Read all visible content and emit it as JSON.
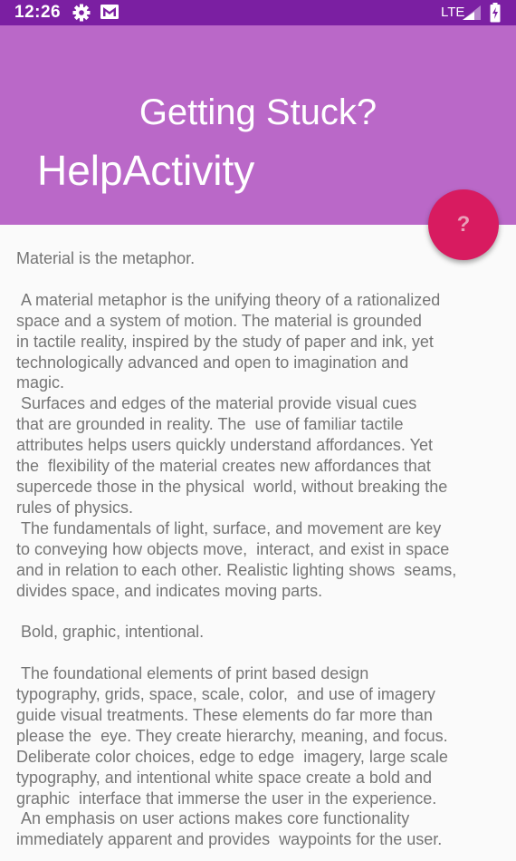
{
  "status_bar": {
    "time": "12:26",
    "network": "LTE",
    "icons": [
      "gear-icon",
      "mail-icon",
      "signal-icon",
      "battery-icon"
    ],
    "color": "#7b1fa2"
  },
  "app_bar": {
    "title": "Getting Stuck?",
    "subtitle": "HelpActivity",
    "color": "#ba68c8"
  },
  "fab": {
    "icon": "question-mark-icon",
    "glyph": "?",
    "color": "#d81b60"
  },
  "content": {
    "text": "Material is the metaphor.\n\n A material metaphor is the unifying theory of a rationalized\nspace and a system of motion. The material is grounded\nin tactile reality, inspired by the study of paper and ink, yet\ntechnologically advanced and open to imagination and\nmagic.\n Surfaces and edges of the material provide visual cues\nthat are grounded in reality. The  use of familiar tactile\nattributes helps users quickly understand affordances. Yet\nthe  flexibility of the material creates new affordances that\nsupercede those in the physical  world, without breaking the\nrules of physics.\n The fundamentals of light, surface, and movement are key\nto conveying how objects move,  interact, and exist in space\nand in relation to each other. Realistic lighting shows  seams,\ndivides space, and indicates moving parts.\n\n Bold, graphic, intentional.\n\n The foundational elements of print based design\ntypography, grids, space, scale, color,  and use of imagery\nguide visual treatments. These elements do far more than\nplease the  eye. They create hierarchy, meaning, and focus.\nDeliberate color choices, edge to edge  imagery, large scale\ntypography, and intentional white space create a bold and\ngraphic  interface that immerse the user in the experience.\n An emphasis on user actions makes core functionality\nimmediately apparent and provides  waypoints for the user."
  }
}
